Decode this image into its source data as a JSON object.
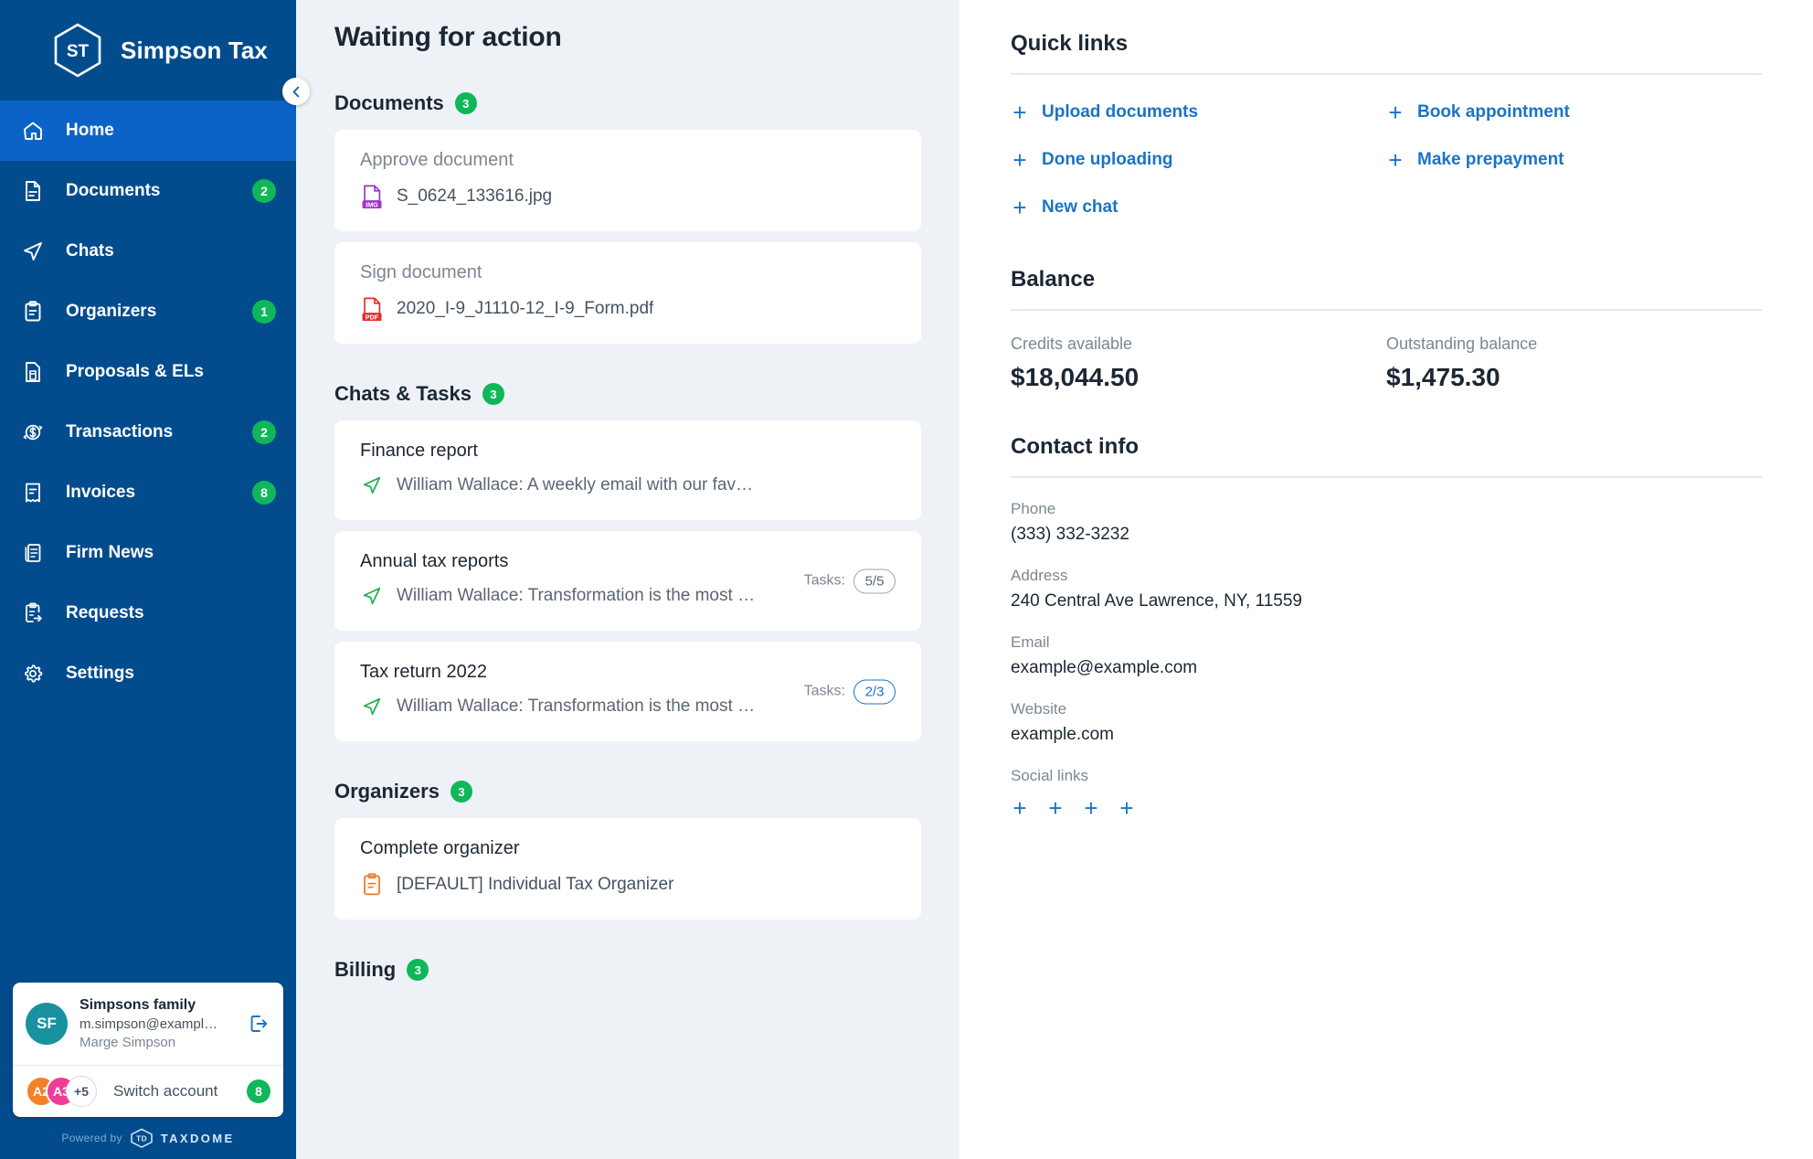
{
  "sidebar": {
    "brand": {
      "initials": "ST",
      "name": "Simpson Tax"
    },
    "collapse_icon": "chevron-left-icon",
    "items": [
      {
        "label": "Home",
        "icon": "home-icon",
        "badge": "",
        "active": true
      },
      {
        "label": "Documents",
        "icon": "document-icon",
        "badge": "2",
        "active": false
      },
      {
        "label": "Chats",
        "icon": "send-icon",
        "badge": "",
        "active": false
      },
      {
        "label": "Organizers",
        "icon": "clipboard-icon",
        "badge": "1",
        "active": false
      },
      {
        "label": "Proposals & ELs",
        "icon": "file-save-icon",
        "badge": "",
        "active": false
      },
      {
        "label": "Transactions",
        "icon": "dollar-sync-icon",
        "badge": "2",
        "active": false
      },
      {
        "label": "Invoices",
        "icon": "receipt-icon",
        "badge": "8",
        "active": false
      },
      {
        "label": "Firm News",
        "icon": "news-icon",
        "badge": "",
        "active": false
      },
      {
        "label": "Requests",
        "icon": "request-icon",
        "badge": "",
        "active": false
      },
      {
        "label": "Settings",
        "icon": "gear-icon",
        "badge": "",
        "active": false
      }
    ],
    "account": {
      "avatar_initials": "SF",
      "avatar_color": "#17929e",
      "name": "Simpsons family",
      "email": "m.simpson@exampl…",
      "person": "Marge Simpson",
      "logout_icon": "logout-icon",
      "switch_label": "Switch account",
      "switch_badge": "8",
      "switch_avatars": [
        {
          "initials": "A2",
          "color": "#f5802a"
        },
        {
          "initials": "A3",
          "color": "#ef3c96"
        }
      ],
      "more_count": "+5"
    },
    "footer": {
      "powered_by": "Powered by",
      "brand_mark": "TD",
      "brand_word": "TAXDOME"
    }
  },
  "main": {
    "page_title": "Waiting for action",
    "sections": [
      {
        "title": "Documents",
        "badge": "3",
        "cards": [
          {
            "action": "Approve document",
            "file": "S_0624_133616.jpg",
            "file_icon": "img-file-icon"
          },
          {
            "action": "Sign document",
            "file": "2020_I-9_J1110-12_I-9_Form.pdf",
            "file_icon": "pdf-file-icon"
          }
        ]
      },
      {
        "title": "Chats & Tasks",
        "badge": "3",
        "chats": [
          {
            "title": "Finance report",
            "message": "William Wallace: A weekly email with our favorite articles about taxe…",
            "tasks_label": "",
            "tasks_value": "",
            "tasks_accent": false
          },
          {
            "title": "Annual tax reports",
            "message": "William Wallace: Transformation is the most discernible…",
            "tasks_label": "Tasks:",
            "tasks_value": "5/5",
            "tasks_accent": false
          },
          {
            "title": "Tax return 2022",
            "message": "William Wallace: Transformation is the most discernible…",
            "tasks_label": "Tasks:",
            "tasks_value": "2/3",
            "tasks_accent": true
          }
        ]
      },
      {
        "title": "Organizers",
        "badge": "3",
        "cards": [
          {
            "action": "Complete organizer",
            "file": "[DEFAULT] Individual Tax Organizer",
            "file_icon": "organizer-icon"
          }
        ]
      },
      {
        "title": "Billing",
        "badge": "3",
        "cards": []
      }
    ]
  },
  "right": {
    "quick_links": {
      "heading": "Quick links",
      "items": [
        {
          "label": "Upload documents",
          "icon": "plus-icon"
        },
        {
          "label": "Book appointment",
          "icon": "plus-icon"
        },
        {
          "label": "Done uploading",
          "icon": "plus-icon"
        },
        {
          "label": "Make prepayment",
          "icon": "plus-icon"
        },
        {
          "label": "New chat",
          "icon": "plus-icon"
        }
      ]
    },
    "balance": {
      "heading": "Balance",
      "credits_label": "Credits available",
      "credits_value": "$18,044.50",
      "outstanding_label": "Outstanding balance",
      "outstanding_value": "$1,475.30"
    },
    "contact": {
      "heading": "Contact info",
      "phone_label": "Phone",
      "phone_value": "(333) 332-3232",
      "address_label": "Address",
      "address_value": "240 Central Ave Lawrence, NY, 11559",
      "email_label": "Email",
      "email_value": "example@example.com",
      "website_label": "Website",
      "website_value": "example.com",
      "social_label": "Social links",
      "social_count": 4
    }
  },
  "colors": {
    "sidebar_bg": "#024c8e",
    "sidebar_active": "#0b63c7",
    "accent_blue": "#1a73c7",
    "badge_green": "#10b759",
    "page_bg": "#eef2f7"
  }
}
